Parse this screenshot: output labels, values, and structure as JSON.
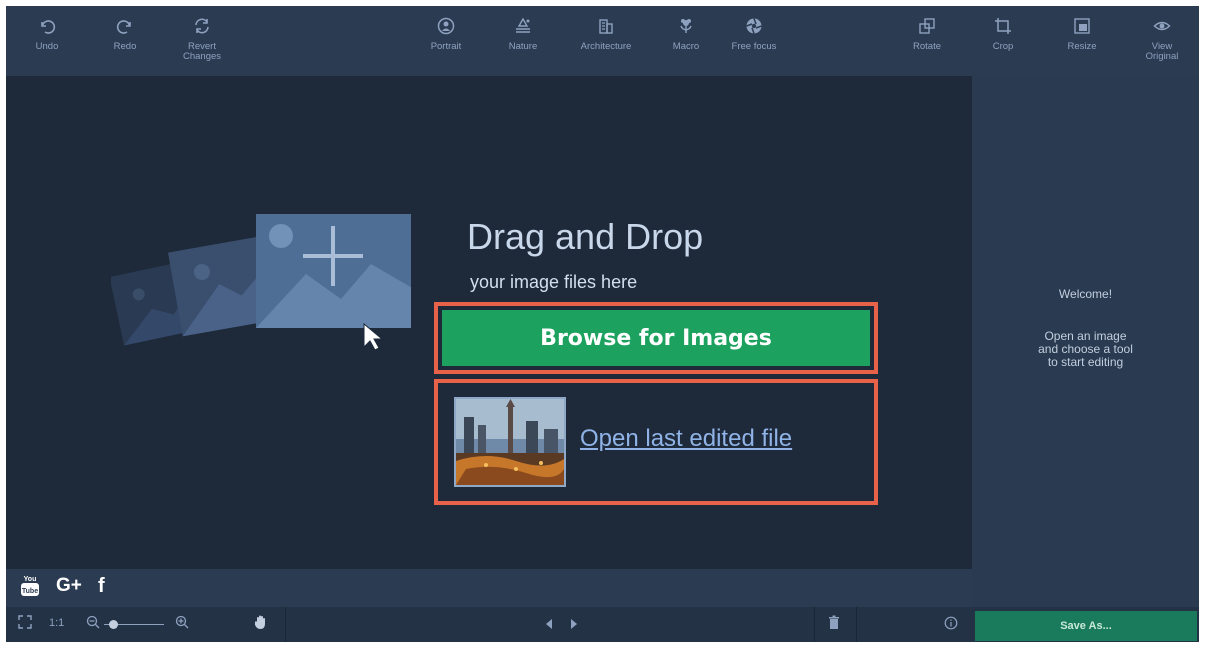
{
  "toolbar": {
    "undo_label": "Undo",
    "redo_label": "Redo",
    "revert_label": "Revert\nChanges",
    "portrait_label": "Portrait",
    "nature_label": "Nature",
    "architecture_label": "Architecture",
    "macro_label": "Macro",
    "freefocus_label": "Free focus",
    "rotate_label": "Rotate",
    "crop_label": "Crop",
    "resize_label": "Resize",
    "view_original_label": "View\nOriginal"
  },
  "main": {
    "drag_title": "Drag and Drop",
    "drag_subtitle": "your image files here",
    "browse_label": "Browse for Images",
    "open_last_label": "Open last edited file"
  },
  "right_panel": {
    "welcome": "Welcome!",
    "instructions": "Open an image\nand choose a tool\nto start editing"
  },
  "social": {
    "youtube": "You\nTube",
    "googleplus": "G+",
    "facebook": "f"
  },
  "bottom": {
    "one_to_one": "1:1",
    "save_as_label": "Save As...",
    "zoom_level": 0.15
  },
  "colors": {
    "accent_green": "#1ca15e",
    "highlight_red": "#e8624a",
    "background": "#1e2a3a",
    "toolbar": "#2b3b52"
  }
}
